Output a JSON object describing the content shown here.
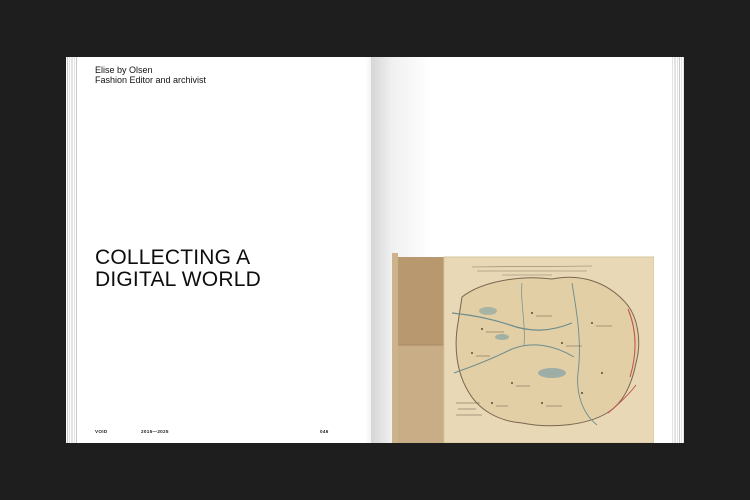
{
  "spread": {
    "left_page": {
      "author_name": "Elise by Olsen",
      "author_role": "Fashion Editor and archivist",
      "title_line1": "COLLECTING A",
      "title_line2": "DIGITAL WORLD",
      "footer": {
        "publication": "VOID",
        "years": "2015—2025",
        "page_number": "046"
      }
    },
    "right_page": {
      "plate": "hand-drawn antique map on aged paper beside a tan card folder"
    }
  },
  "colors": {
    "background": "#1e1e1e",
    "page": "#ffffff",
    "paper": "#e8d8b6",
    "folder": "#b8996f",
    "ink": "#5a4a3a"
  }
}
